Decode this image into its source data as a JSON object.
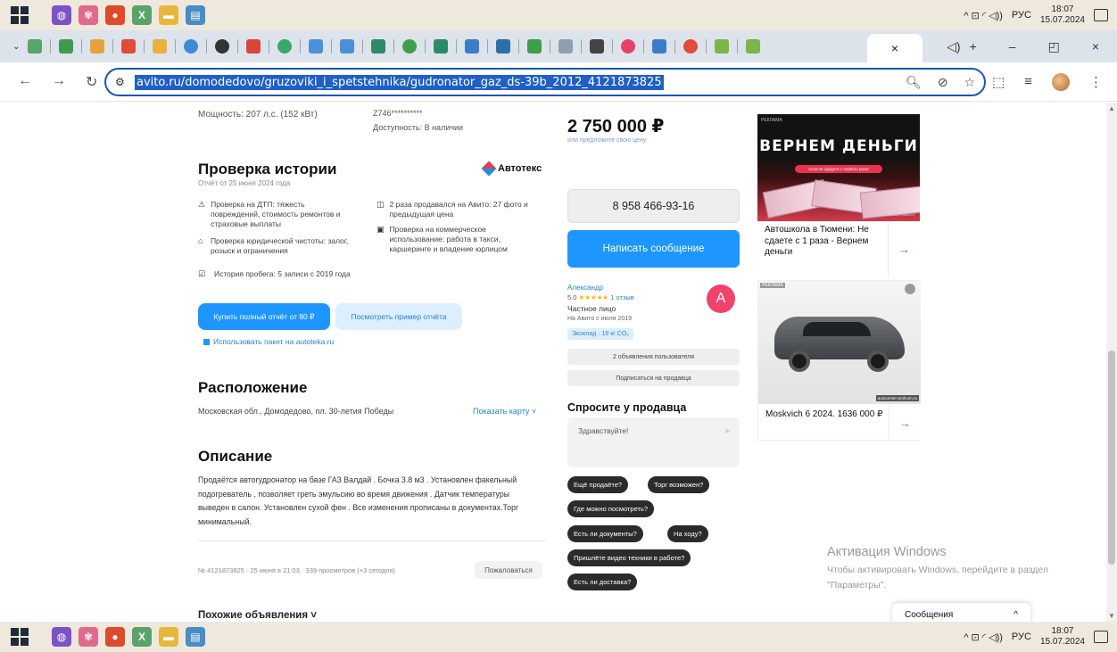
{
  "taskbar": {
    "lang": "РУС",
    "time": "18:07",
    "date": "15.07.2024",
    "tray": "^ ⊡ ◜ ◁))",
    "apps": [
      {
        "name": "viber-icon",
        "color": "#7d52c7",
        "glyph": "◍"
      },
      {
        "name": "network-app-icon",
        "color": "#e06a8c",
        "glyph": "✾"
      },
      {
        "name": "chrome-icon",
        "color": "#e04a2c",
        "glyph": "●"
      },
      {
        "name": "excel-icon",
        "color": "#5aa36a",
        "glyph": "X"
      },
      {
        "name": "folder-icon",
        "color": "#e7b73c",
        "glyph": "▬"
      },
      {
        "name": "notes-app-icon",
        "color": "#4a8cc6",
        "glyph": "▤"
      }
    ]
  },
  "browser": {
    "url": "avito.ru/domodedovo/gruzoviki_i_spetstehnika/gudronator_gaz_ds-39b_2012_4121873825",
    "tab_close": "×",
    "tab_audio": "◁)",
    "new_tab": "+",
    "min": "–",
    "restore": "◰",
    "close": "×"
  },
  "specs": {
    "power": "Мощность: 207 л.с. (152 кВт)",
    "vin": "Z746**********",
    "availability": "Доступность: В наличии"
  },
  "history": {
    "title": "Проверка истории",
    "provider": "Автотекс",
    "report_date": "Отчёт от 25 июня 2024 года",
    "items": [
      {
        "icon": "car-crash-icon",
        "glyph": "⚠",
        "text": "Проверка на ДТП: тяжесть повреждений, стоимость ремонтов и страховые выплаты"
      },
      {
        "icon": "legal-icon",
        "glyph": "⌂",
        "text": "Проверка юридической чистоты: залог, розыск и ограничения"
      },
      {
        "icon": "odometer-icon",
        "glyph": "☑",
        "text": "История пробега: 5 записи с 2019 года"
      },
      {
        "icon": "sold-icon",
        "glyph": "◫",
        "text": "2 раза продавался на Авито: 27 фото и предыдущая цена"
      },
      {
        "icon": "commercial-icon",
        "glyph": "▣",
        "text": "Проверка на коммерческое использование: работа в такси, каршеринге и владение юрлицом"
      }
    ],
    "buy_button": "Купить полный отчёт от 80 ₽",
    "example_button": "Посмотреть пример отчёта",
    "pack_link": "Использовать пакет на autoteka.ru"
  },
  "location": {
    "title": "Расположение",
    "address": "Московская обл., Домодедово, пл. 30-летия Победы",
    "map_link": "Показать карту ˅"
  },
  "description": {
    "title": "Описание",
    "text": "Продаётся автогудронатор на базе ГАЗ Валдай . Бочка 3.8 м3 . Установлен факельный подогреватель , позволяет греть эмульсию во время движения . Датчик температуры выведен в салон. Установлен сухой фен . Все изменения прописаны в документах.Торг минимальный."
  },
  "meta": {
    "text": "№ 4121873825 · 25 июня в 21:03 · 339 просмотров (+3 сегодня)",
    "complain": "Пожаловаться"
  },
  "similar": "Похожие объявления ˅",
  "sidebar": {
    "price": "2 750 000 ₽",
    "price_sub": "или предложите свою цену",
    "phone": "8 958 466-93-16",
    "message_button": "Написать сообщение",
    "seller": {
      "name": "Александр",
      "rating": "5.0",
      "stars": "★★★★★",
      "reviews": "1 отзыв",
      "type": "Частное лицо",
      "since": "На Авито с июля 2019",
      "eco": "Экоклад · 19 кг CO₂",
      "avatar_letter": "A"
    },
    "ads_button": "2 объявления пользователя",
    "subscribe_button": "Подписаться на продавца",
    "ask_title": "Спросите у продавца",
    "ask_placeholder": "Здравствуйте!",
    "chips": [
      "Ещё продаёте?",
      "Торг возможен?",
      "Где можно посмотреть?",
      "Есть ли документы?",
      "На ходу?",
      "Пришлёте видео техники в работе?",
      "Есть ли доставка?"
    ]
  },
  "ads": {
    "ad1": {
      "label": "РЕКЛАМА",
      "headline": "ВЕРНЕМ ДЕНЬГИ",
      "pill": "если не сдадите с первого раза!",
      "site": "avtoschool-yolka.ru",
      "text": "Автошкола в Тюмени: Не сдаете с 1 раза - Вернем деньги"
    },
    "ad2": {
      "label": "РЕКЛАМА",
      "site": "autocenter-profcom.ru",
      "text": "Moskvich 6 2024. 1636 000 ₽"
    }
  },
  "activation": {
    "title": "Активация Windows",
    "text": "Чтобы активировать Windows, перейдите в раздел \"Параметры\"."
  },
  "messages_widget": {
    "label": "Сообщения",
    "toggle": "^"
  }
}
